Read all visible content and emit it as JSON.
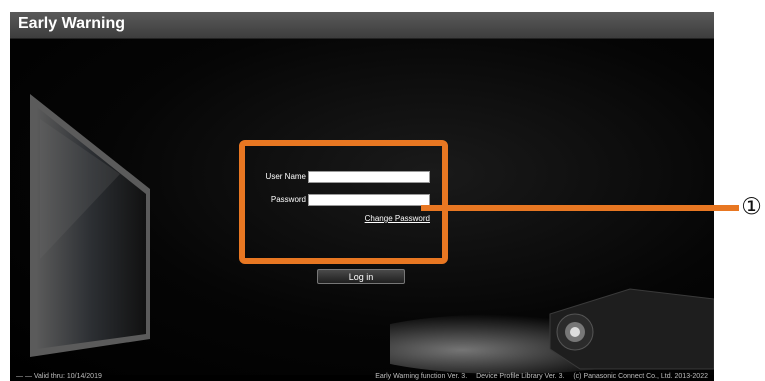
{
  "window": {
    "title": "Early Warning"
  },
  "login": {
    "username_label": "User Name",
    "username_value": "",
    "password_label": "Password",
    "password_value": "",
    "change_password_link": "Change Password",
    "login_button": "Log in"
  },
  "footer": {
    "valid_thru": "— — Valid thru: 10/14/2019",
    "version_info": "Early Warning function Ver. 3.   Device Profile Library Ver. 3.   (c) Panasonic Connect Co., Ltd. 2013-2022"
  },
  "callout": {
    "number": "①"
  },
  "colors": {
    "accent": "#e87722",
    "titlebar": "#4a4a4a",
    "background": "#000000"
  }
}
